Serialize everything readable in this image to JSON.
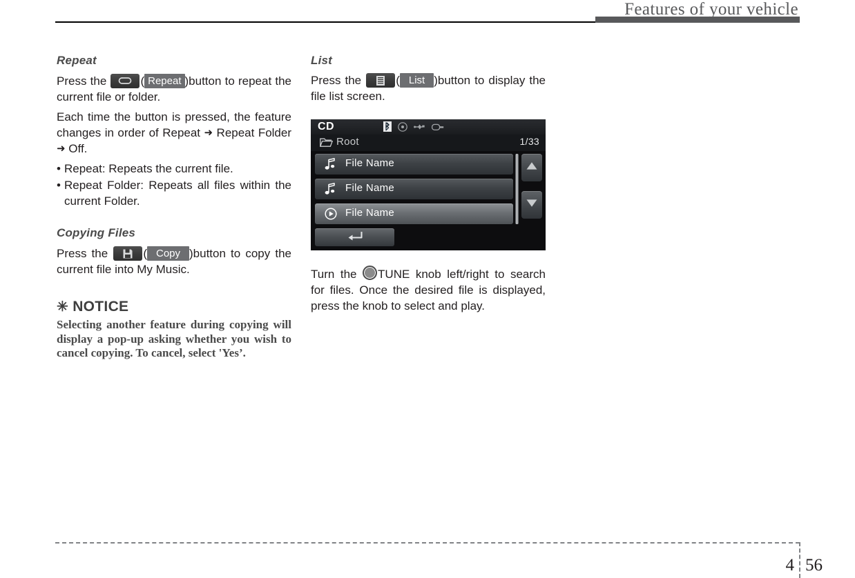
{
  "header": {
    "title": "Features of your vehicle"
  },
  "footer": {
    "chapter": "4",
    "page": "56"
  },
  "left_column": {
    "repeat_section": {
      "heading": "Repeat",
      "line1_pre": "Press the ",
      "line1_paren_open": "(",
      "button_label": "Repeat",
      "line1_post": ")button to repeat the current file or folder.",
      "paragraph2_a": "Each time the button is pressed, the feature changes in order of Repeat ",
      "arrow1": "➜",
      "paragraph2_b": " Repeat Folder ",
      "arrow2": "➜",
      "paragraph2_c": " Off.",
      "bullets": [
        "Repeat: Repeats the current file.",
        "Repeat Folder: Repeats all files within the current Folder."
      ],
      "icon_name": "repeat-loop-icon"
    },
    "copying_section": {
      "heading": "Copying Files",
      "line1_pre": "Press the ",
      "line1_paren_open": "(",
      "button_label": "Copy",
      "line1_post": ")button to copy the current file into My Music.",
      "icon_name": "save-floppy-icon"
    },
    "notice": {
      "star": "✳",
      "heading": "NOTICE",
      "body": "Selecting another feature during copying will display a pop-up asking whether you wish to cancel copying. To cancel, select 'Yes’."
    }
  },
  "right_column": {
    "list_section": {
      "heading": "List",
      "line1_pre": "Press the ",
      "line1_paren_open": "(",
      "button_label": "List",
      "line1_post": ")button to display the file list screen.",
      "icon_name": "list-document-icon"
    },
    "tune_paragraph": {
      "pre": "Turn the ",
      "knob_icon": "tune-knob-icon",
      "post": "TUNE knob left/right to search for files. Once the desired file is displayed, press the knob to select and play."
    }
  },
  "cd_screen": {
    "source_title": "CD",
    "status_icons": [
      {
        "name": "bluetooth-icon",
        "highlighted": true
      },
      {
        "name": "disc-icon",
        "highlighted": false
      },
      {
        "name": "usb-icon",
        "highlighted": false
      },
      {
        "name": "aux-jack-icon",
        "highlighted": false
      }
    ],
    "path": {
      "folder_icon": "folder-icon",
      "label": "Root",
      "page_count": "1/33"
    },
    "rows": [
      {
        "icon": "music-note-icon",
        "label": "File Name",
        "active": false
      },
      {
        "icon": "music-note-icon",
        "label": "File Name",
        "active": false
      },
      {
        "icon": "play-circle-icon",
        "label": "File Name",
        "active": true
      }
    ],
    "nav": {
      "up_icon": "arrow-up-icon",
      "down_icon": "arrow-down-icon"
    },
    "back_button_icon": "back-arrow-icon"
  }
}
